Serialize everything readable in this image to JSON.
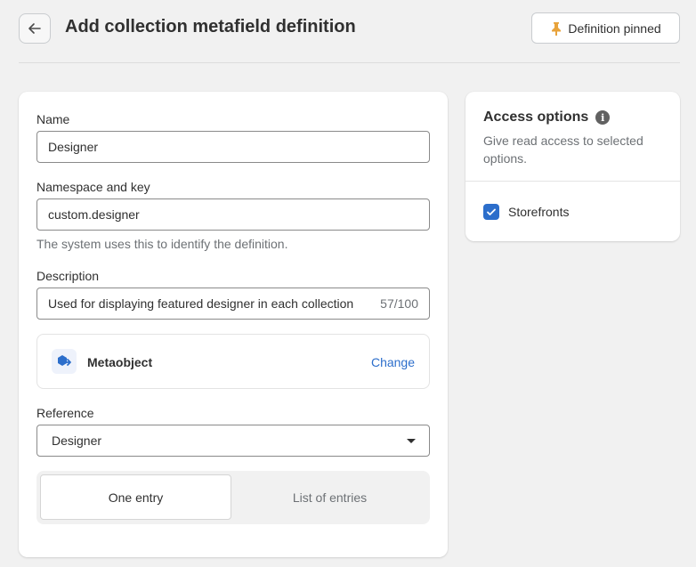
{
  "header": {
    "title": "Add collection metafield definition",
    "pin_label": "Definition pinned"
  },
  "form": {
    "name_label": "Name",
    "name_value": "Designer",
    "namespace_label": "Namespace and key",
    "namespace_value": "custom.designer",
    "namespace_help": "The system uses this to identify the definition.",
    "description_label": "Description",
    "description_value": "Used for displaying featured designer in each collection",
    "description_counter": "57/100",
    "type": {
      "label": "Metaobject",
      "change_label": "Change"
    },
    "reference_label": "Reference",
    "reference_value": "Designer",
    "entries": {
      "one": "One entry",
      "list": "List of entries",
      "selected": "one"
    }
  },
  "access": {
    "title": "Access options",
    "subtitle": "Give read access to selected options.",
    "storefronts_label": "Storefronts",
    "storefronts_checked": true
  },
  "colors": {
    "accent": "#2c6ecb",
    "pin": "#e8a33b"
  }
}
